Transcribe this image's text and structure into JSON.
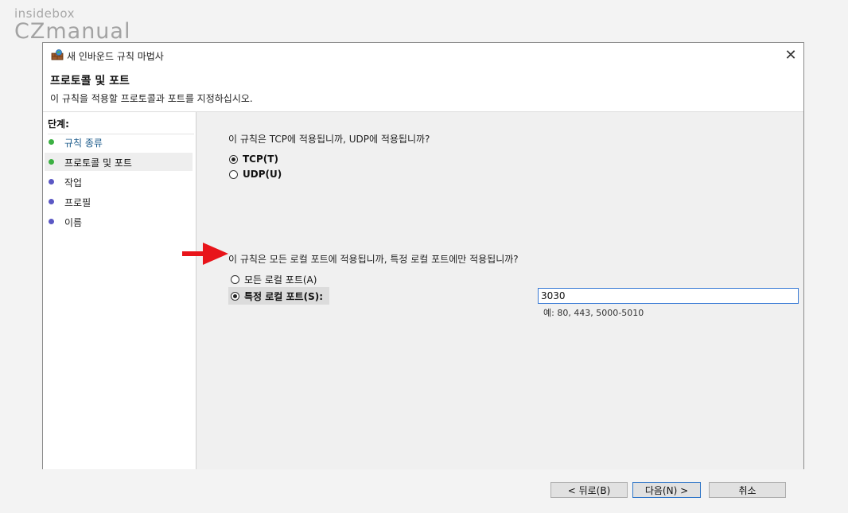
{
  "watermark": {
    "top": "insidebox",
    "bottom": "CZmanual"
  },
  "window": {
    "title": "새 인바운드 규칙 마법사",
    "close_glyph": "✕"
  },
  "header": {
    "title": "프로토콜 및 포트",
    "subtitle": "이 규칙을 적용할 프로토콜과 포트를 지정하십시오."
  },
  "steps": {
    "heading": "단계:",
    "items": [
      {
        "label": "규칙 종류",
        "state": "done",
        "dot_color": "#3cb043"
      },
      {
        "label": "프로토콜 및 포트",
        "state": "active",
        "dot_color": "#3cb043"
      },
      {
        "label": "작업",
        "state": "pending",
        "dot_color": "#5b58c4"
      },
      {
        "label": "프로필",
        "state": "pending",
        "dot_color": "#5b58c4"
      },
      {
        "label": "이름",
        "state": "pending",
        "dot_color": "#5b58c4"
      }
    ]
  },
  "protocol": {
    "question": "이 규칙은 TCP에 적용됩니까, UDP에 적용됩니까?",
    "options": [
      {
        "label": "TCP(T)",
        "selected": true
      },
      {
        "label": "UDP(U)",
        "selected": false
      }
    ]
  },
  "ports": {
    "question": "이 규칙은 모든 로컬 포트에 적용됩니까, 특정 로컬 포트에만 적용됩니까?",
    "options": [
      {
        "label": "모든 로컬 포트(A)",
        "selected": false
      },
      {
        "label": "특정 로컬 포트(S):",
        "selected": true
      }
    ],
    "value": "3030",
    "example": "예: 80, 443, 5000-5010"
  },
  "buttons": {
    "back": "< 뒤로(B)",
    "next": "다음(N) >",
    "cancel": "취소"
  },
  "annotation": {
    "arrow_color": "#e8141a"
  }
}
